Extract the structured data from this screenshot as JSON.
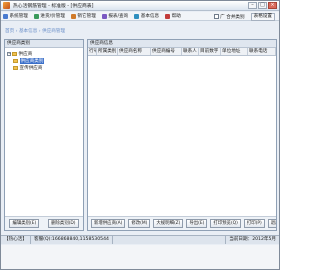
{
  "window": {
    "title": "热心活钢筋管理 - 标准版 - [供应商表]",
    "controls": {
      "minimize": "–",
      "maximize": "□",
      "close": "×"
    }
  },
  "menubar": {
    "items": [
      {
        "label": "系统管理",
        "color": "#4a7bd0"
      },
      {
        "label": "进货/价管理",
        "color": "#3a9a5b"
      },
      {
        "label": "销它管理",
        "color": "#d07a2a"
      },
      {
        "label": "报表/查询",
        "color": "#7a58c2"
      },
      {
        "label": "基本信息",
        "color": "#2e8fbf"
      },
      {
        "label": "帮助",
        "color": "#c23b3b"
      }
    ],
    "open_category_label": "广 合并类别",
    "settings_label": "表格设置"
  },
  "breadcrumb": "首页 › 基本信息 › 供应商管理",
  "left_panel": {
    "header": "供应商类别",
    "tree": {
      "root_label": "供应商",
      "expander": "−",
      "children": [
        {
          "label": "供应商类别",
          "selected": true
        },
        {
          "label": "宣传供应商",
          "selected": false
        }
      ]
    },
    "buttons": {
      "edit": "编辑类别(E)",
      "delete": "删除类别(D)"
    }
  },
  "right_panel": {
    "header": "供应商信息",
    "columns": [
      "行号",
      "所属类别",
      "供应商名称",
      "供应商编号",
      "联系人",
      "目前数字",
      "单位地址",
      "联系电话"
    ],
    "buttons": {
      "add": "新增供应商(A)",
      "modify": "修改(M)",
      "batch": "大规明细(Z)",
      "export": "导出(E)",
      "print_preview": "打印预览(Q)",
      "print": "打印(P)",
      "exit": "退出"
    }
  },
  "statusbar": {
    "label": "【热心活】",
    "phone": "客服(Q):166868840,1158530544",
    "time": "当前日期：2012年5月"
  }
}
